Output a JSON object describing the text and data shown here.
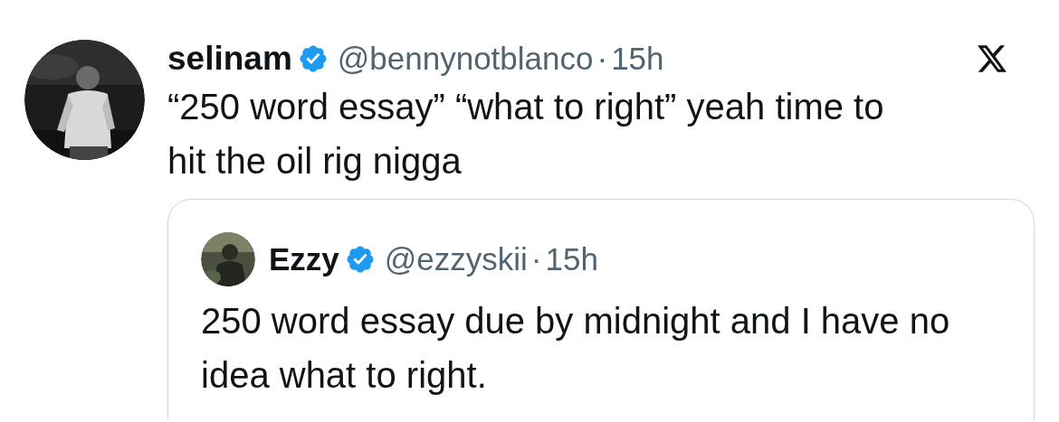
{
  "post": {
    "display_name": "selinam",
    "verified": true,
    "handle": "@bennynotblanco",
    "separator": "·",
    "time": "15h",
    "text": "“250 word essay” “what to right” yeah time to hit the oil rig nigga"
  },
  "quoted_post": {
    "display_name": "Ezzy",
    "verified": true,
    "handle": "@ezzyskii",
    "separator": "·",
    "time": "15h",
    "text": "250 word essay due by midnight and I have no idea what to right."
  }
}
